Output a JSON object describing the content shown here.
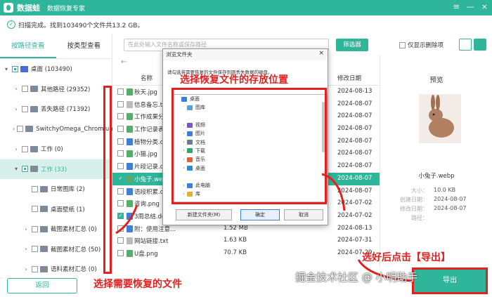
{
  "app": {
    "name": "数据蛙",
    "subtitle": "数据恢复专家",
    "controls": [
      "≡",
      "—",
      "×"
    ]
  },
  "status": {
    "text": "扫描完成。找到103490个文件共13.2 GB。"
  },
  "left_tabs": [
    "按路径查看",
    "按类型查看"
  ],
  "tree": [
    {
      "label": "桌面 (103490)",
      "level": 0,
      "arrow": "▾",
      "check": "part",
      "icon": "pc"
    },
    {
      "label": "其他路径 (29352)",
      "level": 1,
      "arrow": "›",
      "check": "none"
    },
    {
      "label": "丢失路径 (71392)",
      "level": 1,
      "arrow": "›",
      "check": "none"
    },
    {
      "label": "SwitchyOmega_Chromium",
      "level": 1,
      "arrow": "›",
      "check": "none"
    },
    {
      "label": "工作 (0)",
      "level": 1,
      "arrow": "›",
      "check": "none"
    },
    {
      "label": "工作 (33)",
      "level": 1,
      "arrow": "▾",
      "check": "part",
      "selected": true
    },
    {
      "label": "日常图库 (2)",
      "level": 2,
      "arrow": "",
      "check": "none"
    },
    {
      "label": "桌面壁纸 (1)",
      "level": 2,
      "arrow": "",
      "check": "none"
    },
    {
      "label": "截图素材汇总 (0)",
      "level": 2,
      "arrow": "›",
      "check": "none"
    },
    {
      "label": "截图素材汇总 (50)",
      "level": 2,
      "arrow": "›",
      "check": "none"
    },
    {
      "label": "语料素材汇总 (0)",
      "level": 2,
      "arrow": "›",
      "check": "none"
    }
  ],
  "back_label": "返回",
  "search_placeholder": "在此处输入文件名称或保存路径",
  "filter_label": "筛选器",
  "deleted_only_label": "仅显示删除项",
  "columns": {
    "name": "名称",
    "date": "修改日期"
  },
  "files": [
    {
      "name": "秋天.jpg",
      "size": "",
      "type": "",
      "date": "2024-08-13",
      "icon": "img"
    },
    {
      "name": "信息备忘.t",
      "size": "",
      "type": "",
      "date": "2024-08-07",
      "icon": "txt"
    },
    {
      "name": "工作成果分",
      "size": "",
      "type": "",
      "date": "2024-08-07",
      "icon": "img"
    },
    {
      "name": "工作记录表",
      "size": "",
      "type": "",
      "date": "2024-08-07",
      "icon": "img"
    },
    {
      "name": "植物分类.d",
      "size": "",
      "type": "",
      "date": "2024-08-07",
      "icon": "doc"
    },
    {
      "name": "小猫.jpg",
      "size": "",
      "type": "",
      "date": "2024-08-07",
      "icon": "img"
    },
    {
      "name": "片段记录.d",
      "size": "",
      "type": "",
      "date": "2024-08-07",
      "icon": "doc"
    },
    {
      "name": "小兔子.we",
      "size": "",
      "type": "",
      "date": "2024-08-07",
      "icon": "img",
      "selected": true,
      "checked": true
    },
    {
      "name": "语段积累.d",
      "size": "",
      "type": "",
      "date": "2024-08-07",
      "icon": "doc"
    },
    {
      "name": "咨询.png",
      "size": "",
      "type": "",
      "date": "2024-07-02",
      "icon": "img"
    },
    {
      "name": "3周总结.doc",
      "size": "",
      "type": "",
      "date": "2024-07-02",
      "icon": "doc",
      "checked": true
    },
    {
      "name": "附：使用注意...",
      "size": "1.52 MB",
      "type": "2024-08-13",
      "date": "2024-08-13",
      "icon": "doc"
    },
    {
      "name": "网站链接.txt",
      "size": "1.63 KB",
      "type": "2024-07-31",
      "date": "2024-07-31",
      "icon": "txt"
    },
    {
      "name": "U盘.png",
      "size": "70.7 KB",
      "type": "2024-07-29",
      "date": "2024-07-29",
      "icon": "img"
    }
  ],
  "preview": {
    "title": "预览",
    "filename": "小兔子.webp",
    "labels": [
      "大小：",
      "创建日期：",
      "修改日期：",
      "路径："
    ],
    "values": [
      "10.0 KB",
      "2024-08-07",
      "2024-08-07",
      ""
    ]
  },
  "export_label": "导出",
  "dialog": {
    "title": "浏览文件夹",
    "close": "×",
    "message": "请勾选将需要恢复的文件保存到跟丢失数据的磁盘。",
    "tree": [
      {
        "label": "桌面",
        "level": 0,
        "arrow": "",
        "color": "#3d7edb"
      },
      {
        "label": "图库",
        "level": 1,
        "arrow": "",
        "color": "#5aa0e0"
      },
      {
        "label": "",
        "level": 1,
        "arrow": "",
        "color": "#ffffff"
      },
      {
        "label": "视频",
        "level": 1,
        "arrow": "›",
        "color": "#7a55c8"
      },
      {
        "label": "图片",
        "level": 1,
        "arrow": "›",
        "color": "#3d7edb"
      },
      {
        "label": "文档",
        "level": 1,
        "arrow": "›",
        "color": "#6b7c8f"
      },
      {
        "label": "下载",
        "level": 1,
        "arrow": "›",
        "color": "#2fa86a"
      },
      {
        "label": "音乐",
        "level": 1,
        "arrow": "›",
        "color": "#e0603a"
      },
      {
        "label": "桌面",
        "level": 1,
        "arrow": "›",
        "color": "#2a8cd8"
      },
      {
        "label": "",
        "level": 1,
        "arrow": "",
        "color": "#ffffff"
      },
      {
        "label": "此电脑",
        "level": 1,
        "arrow": "›",
        "color": "#3d7edb"
      },
      {
        "label": "库",
        "level": 1,
        "arrow": "›",
        "color": "#e0b030"
      }
    ],
    "new_folder": "新建文件夹(M)",
    "ok": "确定",
    "cancel": "取消"
  },
  "annotations": {
    "dialog_caption": "选择恢复文件的存放位置",
    "files_caption": "选择需要恢复的文件",
    "export_caption": "选好后点击【导出】"
  },
  "watermark": "掘金技术社区 @ 小明助手",
  "colors": {
    "accent": "#2fb59a",
    "annotation": "#e12020"
  }
}
